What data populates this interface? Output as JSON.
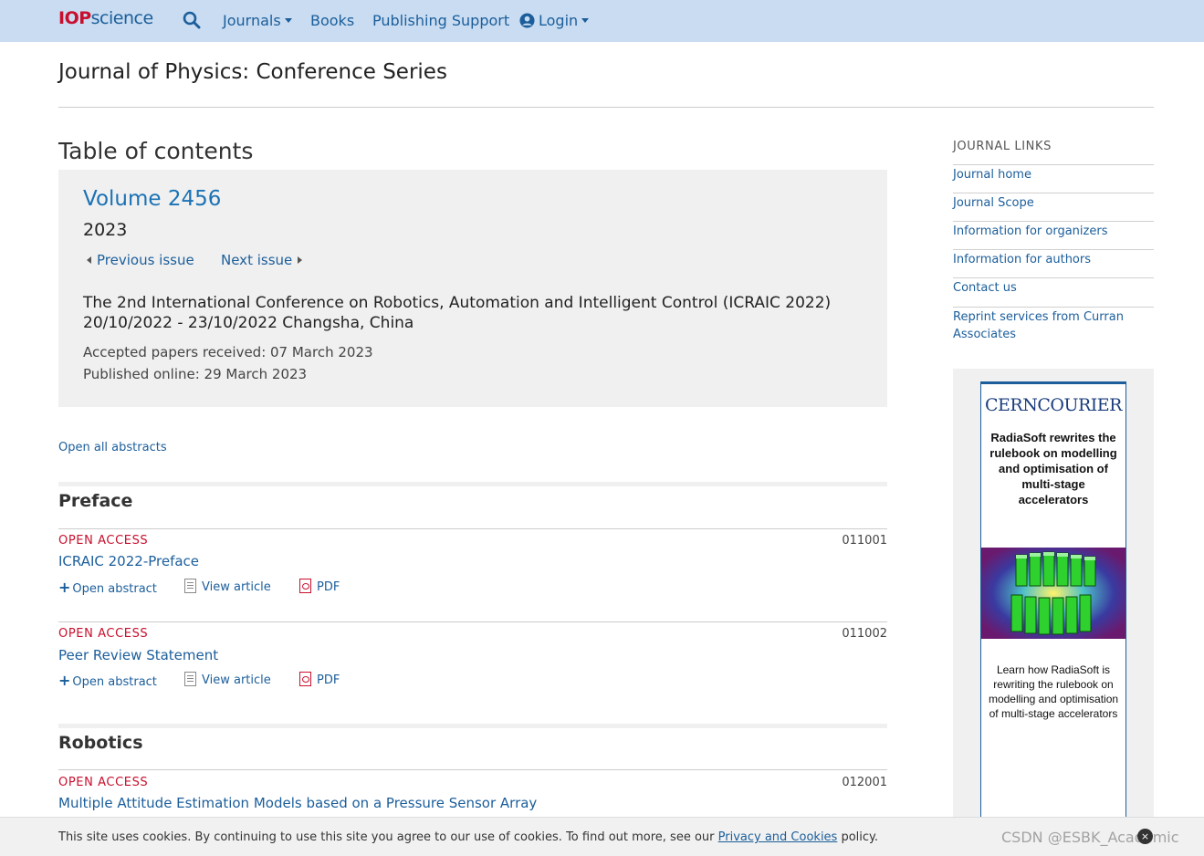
{
  "nav": {
    "logo_a": "IOP",
    "logo_b": "science",
    "journals": "Journals",
    "books": "Books",
    "publishing_support": "Publishing Support",
    "login": "Login"
  },
  "journal_title": "Journal of Physics: Conference Series",
  "toc_heading": "Table of contents",
  "volume": {
    "title": "Volume 2456",
    "year": "2023",
    "prev": "Previous issue",
    "next": "Next issue",
    "conference_line1": "The 2nd International Conference on Robotics, Automation and Intelligent Control (ICRAIC 2022)",
    "conference_line2": "20/10/2022 - 23/10/2022 Changsha, China",
    "accepted": "Accepted papers received: 07 March 2023",
    "published": "Published online: 29 March 2023"
  },
  "open_all": "Open all abstracts",
  "sections": [
    {
      "title": "Preface",
      "articles": [
        {
          "access": "OPEN ACCESS",
          "number": "011001",
          "title": "ICRAIC 2022-Preface"
        },
        {
          "access": "OPEN ACCESS",
          "number": "011002",
          "title": "Peer Review Statement"
        }
      ]
    },
    {
      "title": "Robotics",
      "articles": [
        {
          "access": "OPEN ACCESS",
          "number": "012001",
          "title": "Multiple Attitude Estimation Models based on a Pressure Sensor Array"
        }
      ]
    }
  ],
  "actions": {
    "open_abstract": "Open abstract",
    "view_article": "View article",
    "pdf": "PDF"
  },
  "journal_links": {
    "heading": "JOURNAL LINKS",
    "items": [
      "Journal home",
      "Journal Scope",
      "Information for organizers",
      "Information for authors",
      "Contact us",
      "Reprint services from Curran Associates"
    ]
  },
  "ad": {
    "brand": "CERNCOURIER",
    "headline": "RadiaSoft rewrites the rulebook on modelling and optimisation of multi-stage accelerators",
    "body": "Learn how RadiaSoft is rewriting the rulebook on modelling and optimisation of multi-stage accelerators"
  },
  "cookie": {
    "text_before": "This site uses cookies. By continuing to use this site you agree to our use of cookies. To find out more, see our ",
    "link": "Privacy and Cookies",
    "text_after": " policy.",
    "close": "×"
  },
  "watermark": "CSDN @ESBK_Academic",
  "colors": {
    "nav_bg": "#c9dcf1",
    "link": "#1b5e9b",
    "open_access": "#c8102e",
    "panel_bg": "#f0f0f0"
  }
}
